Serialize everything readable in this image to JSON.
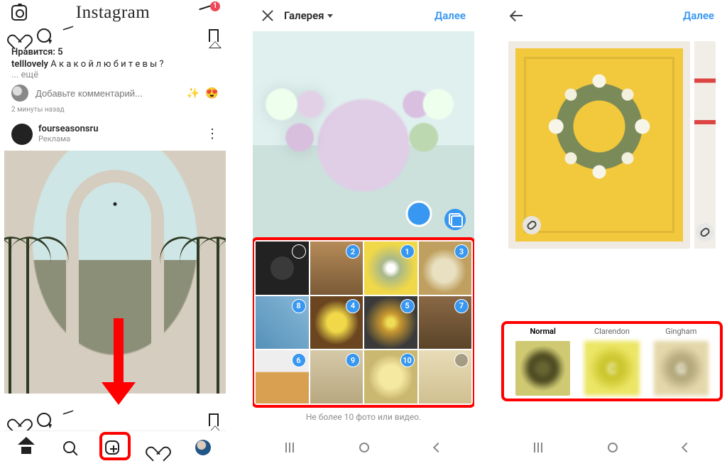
{
  "screen1": {
    "brand": "Instagram",
    "dm_badge": "1",
    "likes_label": "Нравится: 5",
    "caption_user": "telllovely",
    "caption_text": "А  к а к о й   л ю б и т е   в ы ?",
    "more": "... ещё",
    "comment_placeholder": "Добавьте комментарий...",
    "timestamp": "2 минуты назад",
    "post_user": "fourseasonsru",
    "post_sub": "Реклама"
  },
  "screen2": {
    "source_label": "Галерея",
    "next": "Далее",
    "hint": "Не более 10 фото или видео.",
    "selections": [
      "",
      "2",
      "1",
      "3",
      "8",
      "4",
      "5",
      "7",
      "6",
      "9",
      "10",
      ""
    ]
  },
  "screen3": {
    "next": "Далее",
    "filters": [
      {
        "label": "Normal",
        "letter": "",
        "active": true
      },
      {
        "label": "Clarendon",
        "letter": "C",
        "active": false
      },
      {
        "label": "Gingham",
        "letter": "G",
        "active": false
      }
    ]
  }
}
